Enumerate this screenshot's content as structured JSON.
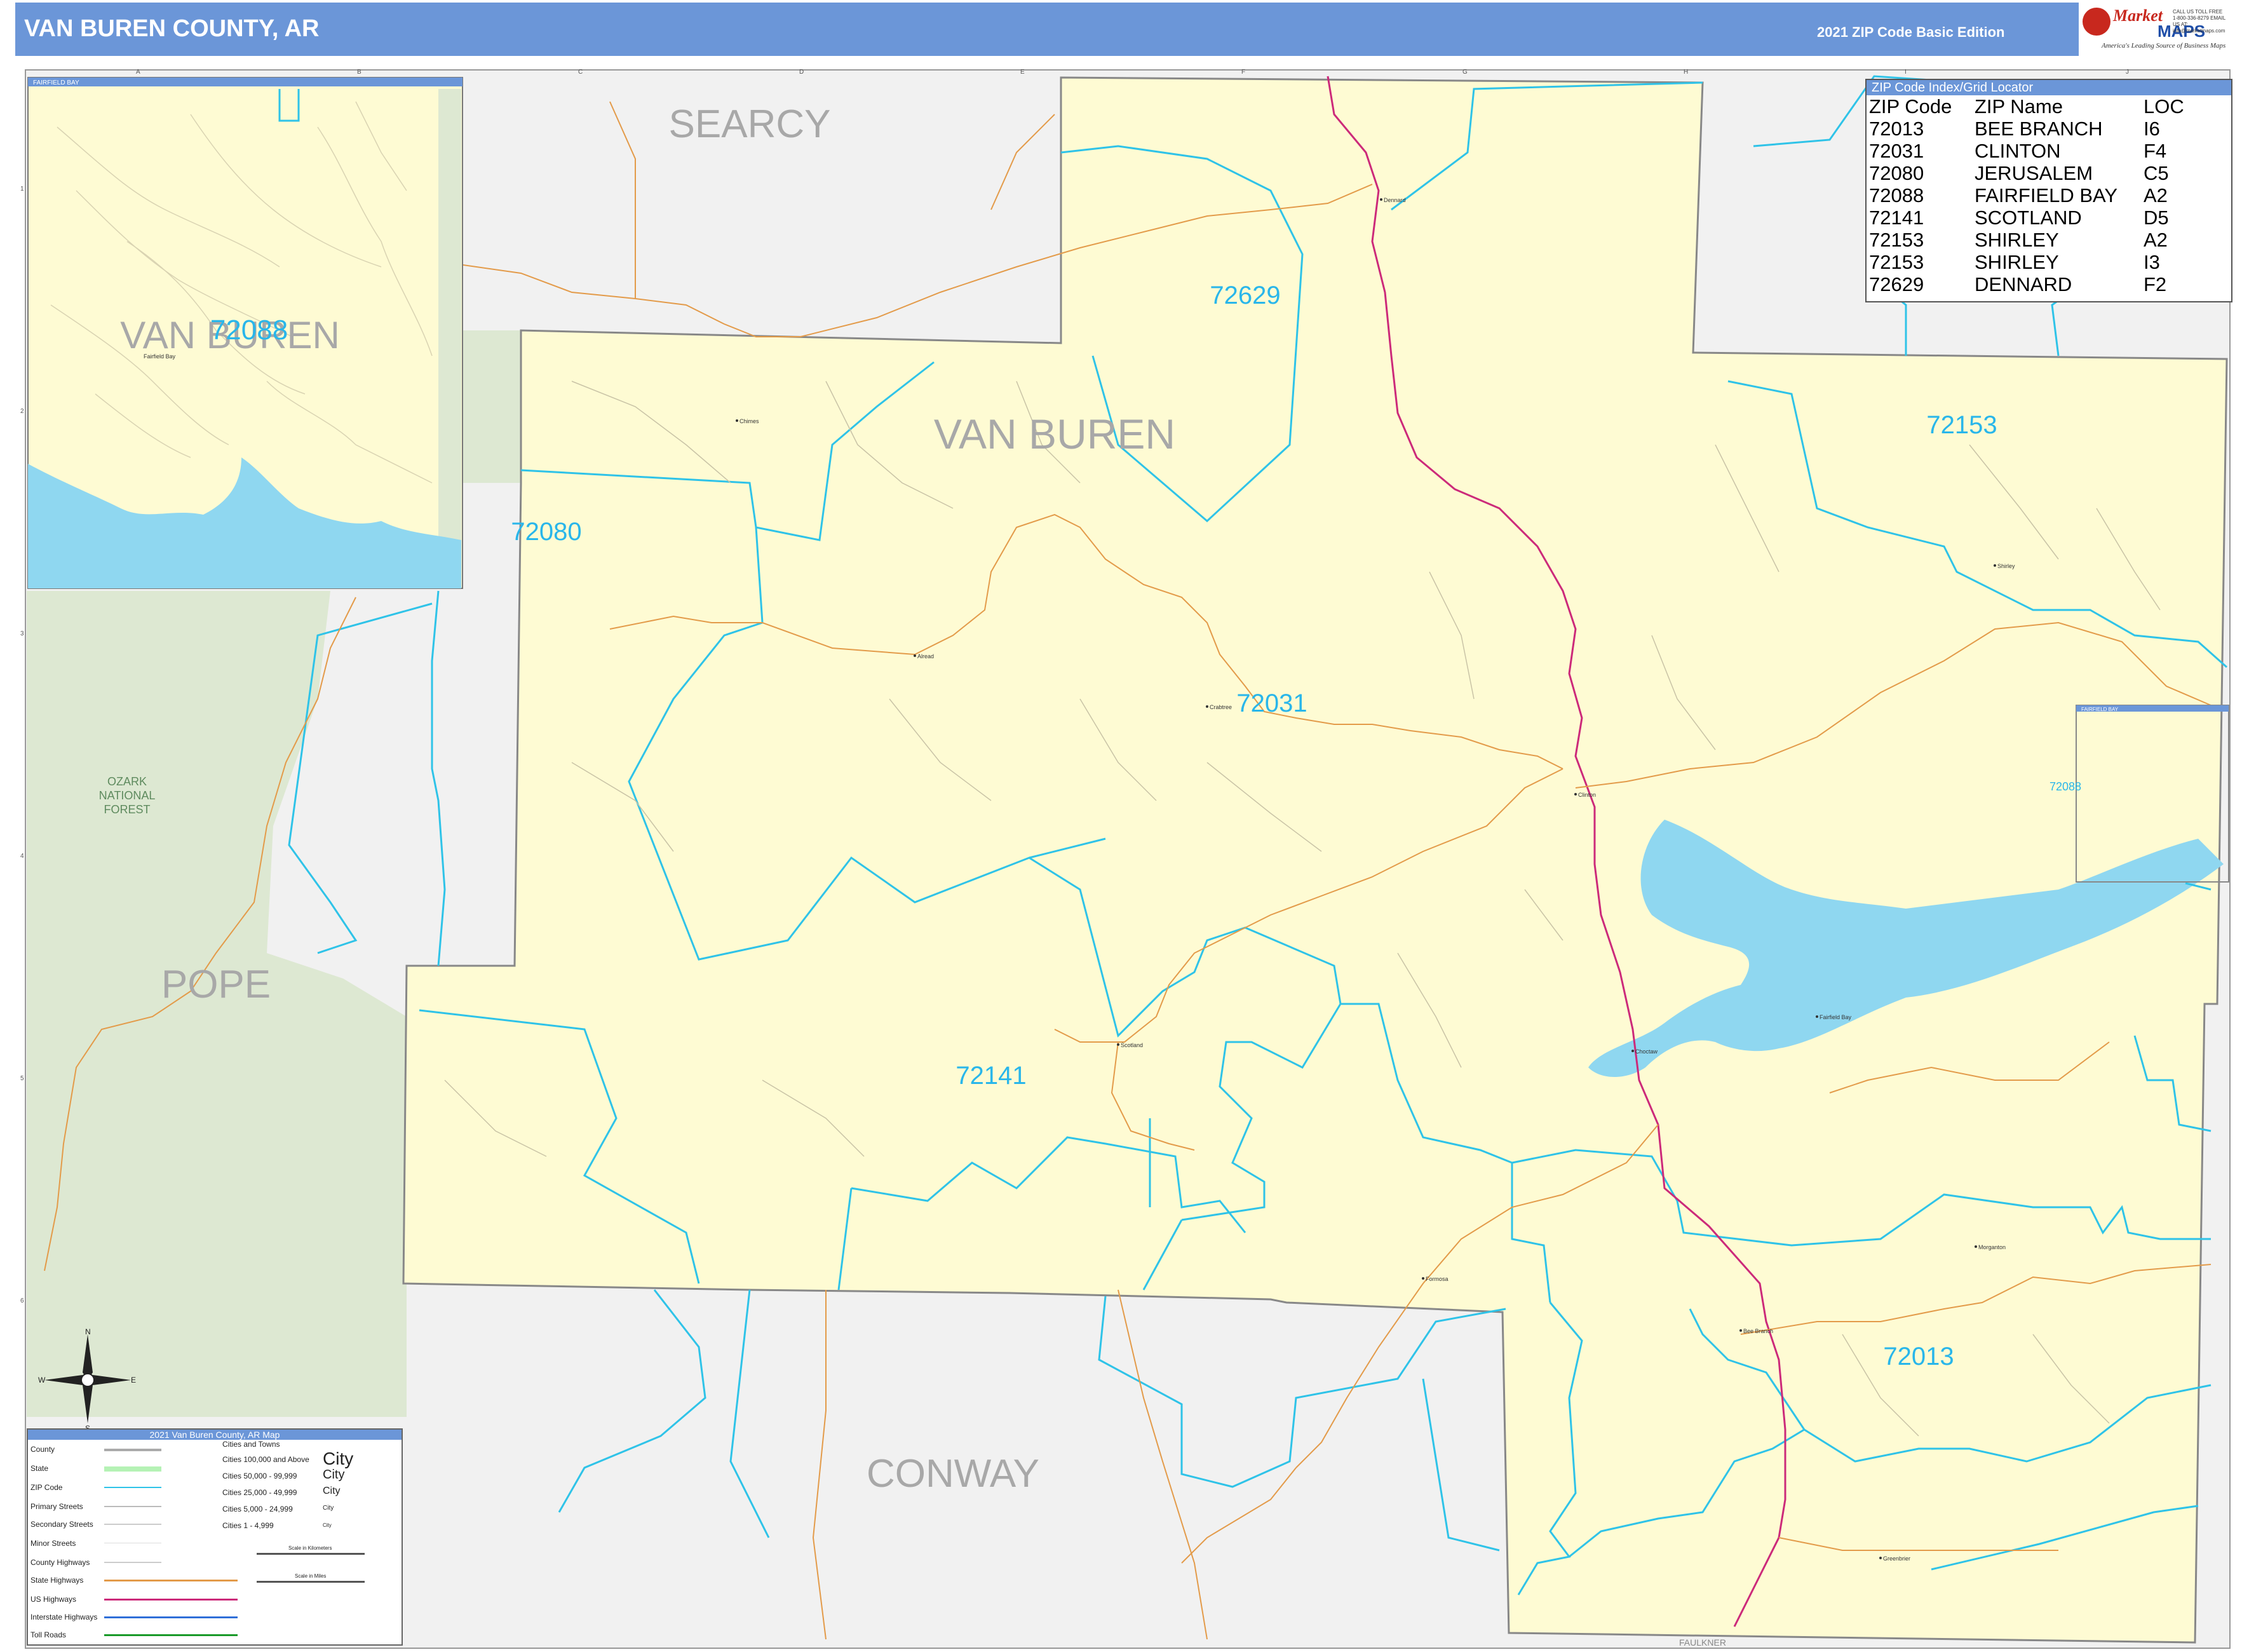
{
  "header": {
    "title": "VAN BUREN COUNTY, AR",
    "edition": "2021 ZIP Code Basic Edition",
    "logo": {
      "word1": "Market",
      "word2": "MAPS",
      "tagline": "America's Leading Source of Business Maps",
      "contact": "CALL US TOLL FREE 1-800-336-8279 EMAIL US AT: info@marketmaps.com"
    }
  },
  "colors": {
    "header": "#6b96d8",
    "county_fill": "#fefbd3",
    "outside_fill": "#f1f1f1",
    "forest": "#dde8d2",
    "water": "#8fd7f0",
    "zip_boundary": "#2fc3e8",
    "zip_label": "#29b6ea",
    "county_label": "#a8a8a8",
    "state_hwy": "#e39b4a",
    "us_hwy": "#cc2a7a"
  },
  "counties": {
    "searcy": "SEARCY",
    "van_buren": "VAN BUREN",
    "pope": "POPE",
    "conway": "CONWAY",
    "faulkner": "FAULKNER"
  },
  "forest_label": {
    "line1": "OZARK",
    "line2": "NATIONAL",
    "line3": "FOREST"
  },
  "zip_labels": [
    "72629",
    "72153",
    "72080",
    "72031",
    "72141",
    "72013",
    "72088"
  ],
  "towns": [
    "Dennard",
    "Chimes",
    "Alread",
    "Crabtree",
    "Scotland",
    "Choctaw",
    "Formosa",
    "Bee Branch",
    "Morganton",
    "Greenbrier",
    "Shirley",
    "Fairfield Bay",
    "Clinton"
  ],
  "grid": {
    "cols": [
      "A",
      "B",
      "C",
      "D",
      "E",
      "F",
      "G",
      "H",
      "I",
      "J"
    ],
    "rows": [
      "1",
      "2",
      "3",
      "4",
      "5",
      "6"
    ]
  },
  "inset": {
    "title": "FAIRFIELD BAY",
    "county": "VAN BUREN",
    "zip": "72088",
    "town": "Fairfield Bay"
  },
  "inset_small": {
    "title": "FAIRFIELD BAY",
    "zip": "72088"
  },
  "index": {
    "title": "ZIP Code Index/Grid Locator",
    "headers": [
      "ZIP Code",
      "ZIP Name",
      "LOC"
    ],
    "rows": [
      [
        "72013",
        "BEE BRANCH",
        "I6"
      ],
      [
        "72031",
        "CLINTON",
        "F4"
      ],
      [
        "72080",
        "JERUSALEM",
        "C5"
      ],
      [
        "72088",
        "FAIRFIELD BAY",
        "A2"
      ],
      [
        "72141",
        "SCOTLAND",
        "D5"
      ],
      [
        "72153",
        "SHIRLEY",
        "A2"
      ],
      [
        "72153",
        "SHIRLEY",
        "I3"
      ],
      [
        "72629",
        "DENNARD",
        "F2"
      ]
    ]
  },
  "compass": {
    "n": "N",
    "s": "S",
    "e": "E",
    "w": "W"
  },
  "legend": {
    "title": "2021 Van Buren County, AR Map",
    "left": [
      "County",
      "State",
      "ZIP Code",
      "Primary Streets",
      "Secondary Streets",
      "Minor Streets",
      "County Highways",
      "State Highways",
      "US Highways",
      "Interstate Highways",
      "Toll Roads"
    ],
    "cities_title": "Cities and Towns",
    "cities": [
      {
        "label": "Cities 100,000 and Above",
        "sample": "City"
      },
      {
        "label": "Cities 50,000 - 99,999",
        "sample": "City"
      },
      {
        "label": "Cities 25,000 - 49,999",
        "sample": "City"
      },
      {
        "label": "Cities 5,000 - 24,999",
        "sample": "City"
      },
      {
        "label": "Cities 1 - 4,999",
        "sample": "City"
      }
    ],
    "scale_km": "Scale in Kilometers",
    "scale_mi": "Scale in Miles"
  }
}
